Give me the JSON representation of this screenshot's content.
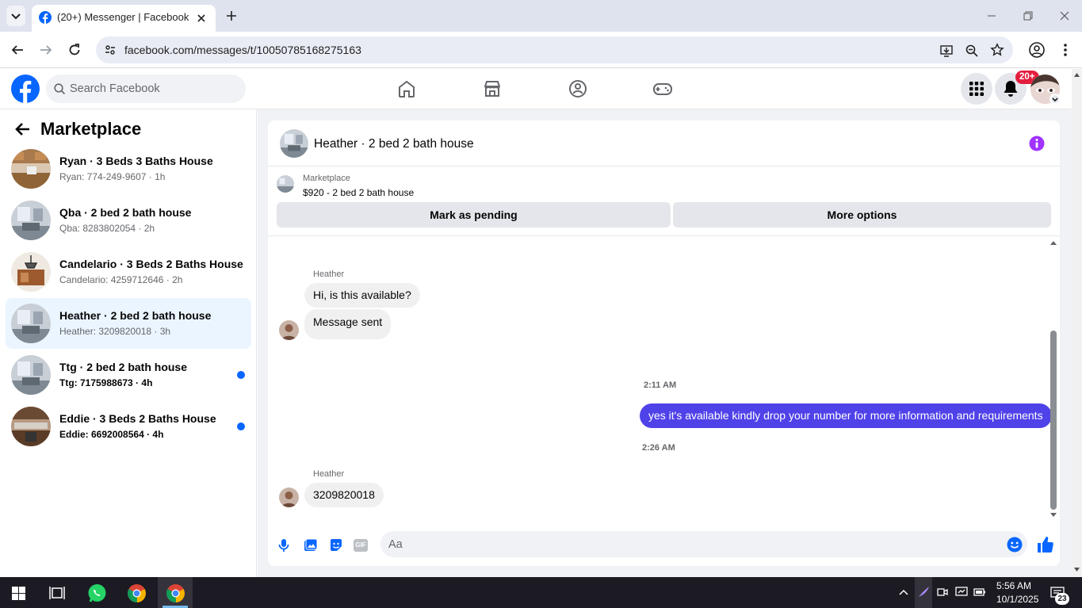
{
  "browser": {
    "tab_title": "(20+) Messenger | Facebook",
    "url": "facebook.com/messages/t/10050785168275163"
  },
  "facebook": {
    "search_placeholder": "Search Facebook",
    "notification_badge": "20+"
  },
  "sidebar": {
    "title": "Marketplace",
    "conversations": [
      {
        "title": "Ryan · 3 Beds 3 Baths House",
        "snippet": "Ryan: 774-249-9607 · 1h",
        "unread": false,
        "active": false
      },
      {
        "title": "Qba · 2 bed 2 bath house",
        "snippet": "Qba: 8283802054 · 2h",
        "unread": false,
        "active": false
      },
      {
        "title": "Candelario · 3 Beds 2 Baths House",
        "snippet": "Candelario: 4259712646 · 2h",
        "unread": false,
        "active": false
      },
      {
        "title": "Heather · 2 bed 2 bath house",
        "snippet": "Heather: 3209820018 · 3h",
        "unread": false,
        "active": true
      },
      {
        "title": "Ttg · 2 bed 2 bath house",
        "snippet": "Ttg: 7175988673 · 4h",
        "unread": true,
        "active": false
      },
      {
        "title": "Eddie · 3 Beds 2 Baths House",
        "snippet": "Eddie: 6692008564 · 4h",
        "unread": true,
        "active": false
      }
    ]
  },
  "chat": {
    "title": "Heather · 2 bed 2 bath house",
    "listing_label": "Marketplace",
    "listing_price": "$920 - 2 bed 2 bath house",
    "mark_pending_label": "Mark as pending",
    "more_options_label": "More options",
    "messages": {
      "sender1": "Heather",
      "msg1": "Hi, is this available?",
      "msg2": "Message sent",
      "time1": "2:11 AM",
      "msg3": "yes it's available kindly drop your number for more information and requirements",
      "time2": "2:26 AM",
      "sender2": "Heather",
      "msg4": "3209820018"
    },
    "compose_placeholder": "Aa",
    "gif_label": "GIF"
  },
  "taskbar": {
    "time": "5:56 AM",
    "date": "10/1/2025",
    "notif_count": "23"
  },
  "colors": {
    "facebook_blue": "#0866ff",
    "my_bubble": "#4f42e9",
    "info_purple": "#a033ff"
  }
}
